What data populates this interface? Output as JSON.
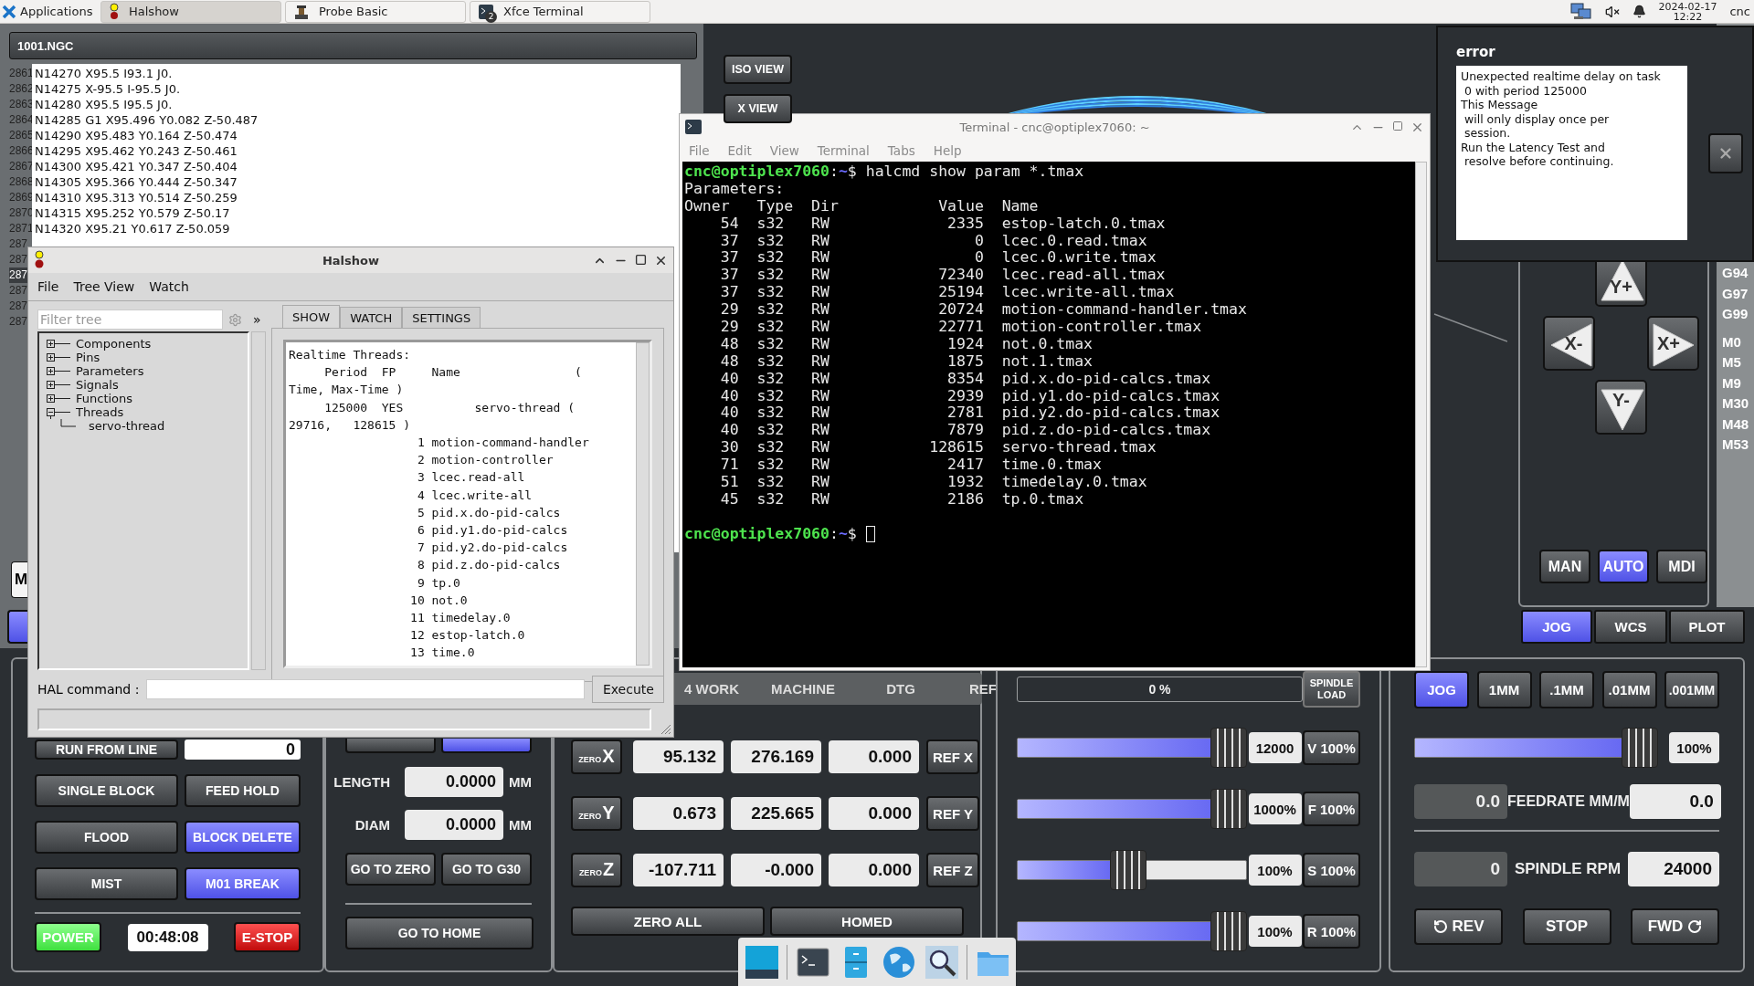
{
  "top_panel": {
    "applications": "Applications",
    "tasks": [
      {
        "label": "Halshow",
        "kind": "halshow",
        "selected": true
      },
      {
        "label": "Probe Basic",
        "kind": "probe",
        "selected": false
      },
      {
        "label": "Xfce Terminal",
        "kind": "terminal",
        "selected": false,
        "badge": "2"
      }
    ],
    "date": "2024-02-17",
    "time": "12:22",
    "user": "cnc"
  },
  "probe_basic": {
    "file_title": "1001.NGC",
    "code_lines": [
      {
        "number": "2861",
        "text": "N14270 X95.5 I93.1 J0.",
        "selected": false
      },
      {
        "number": "2862",
        "text": "N14275 X-95.5 I-95.5 J0.",
        "selected": false
      },
      {
        "number": "2863",
        "text": "N14280 X95.5 I95.5 J0.",
        "selected": false
      },
      {
        "number": "2864",
        "text": "N14285 G1 X95.496 Y0.082 Z-50.487",
        "selected": false
      },
      {
        "number": "2865",
        "text": "N14290 X95.483 Y0.164 Z-50.474",
        "selected": false
      },
      {
        "number": "2866",
        "text": "N14295 X95.462 Y0.243 Z-50.461",
        "selected": false
      },
      {
        "number": "2867",
        "text": "N14300 X95.421 Y0.347 Z-50.404",
        "selected": false
      },
      {
        "number": "2868",
        "text": "N14305 X95.366 Y0.444 Z-50.347",
        "selected": false
      },
      {
        "number": "2869",
        "text": "N14310 X95.313 Y0.514 Z-50.259",
        "selected": false
      },
      {
        "number": "2870",
        "text": "N14315 X95.252 Y0.579 Z-50.17",
        "selected": false
      },
      {
        "number": "2871",
        "text": "N14320 X95.21 Y0.617 Z-50.059",
        "selected": false
      },
      {
        "number": "287",
        "selected": false
      },
      {
        "number": "287",
        "selected": false
      },
      {
        "number": "287",
        "selected": true
      },
      {
        "number": "287",
        "selected": false
      },
      {
        "number": "287",
        "selected": false
      },
      {
        "number": "287",
        "selected": false
      }
    ],
    "mode_stub": "M",
    "view_buttons": [
      "ISO VIEW",
      "X VIEW"
    ],
    "active_gcodes": [
      "G94",
      "G97",
      "G99"
    ],
    "active_mcodes": [
      "M0",
      "M5",
      "M9",
      "M30",
      "M48",
      "M53"
    ],
    "jog_buttons": [
      {
        "label": "Y+",
        "kind": "up"
      },
      {
        "label": "X-",
        "kind": "left"
      },
      {
        "label": "X+",
        "kind": "right"
      },
      {
        "label": "Y-",
        "kind": "down"
      }
    ],
    "modes": [
      {
        "label": "MAN",
        "selected": false
      },
      {
        "label": "AUTO",
        "selected": true
      },
      {
        "label": "MDI",
        "selected": false
      }
    ],
    "view_tabs": [
      {
        "label": "JOG",
        "selected": true
      },
      {
        "label": "WCS",
        "selected": false
      },
      {
        "label": "PLOT",
        "selected": false
      }
    ],
    "program_controls": {
      "run_from_line": "RUN FROM LINE",
      "line_value": "0",
      "toggles": [
        {
          "label": "SINGLE BLOCK",
          "on": false
        },
        {
          "label": "FEED HOLD",
          "on": false
        },
        {
          "label": "FLOOD",
          "on": false
        },
        {
          "label": "BLOCK DELETE",
          "on": true
        },
        {
          "label": "MIST",
          "on": false
        },
        {
          "label": "M01 BREAK",
          "on": true
        }
      ],
      "power": "POWER",
      "timer": "00:48:08",
      "estop": "E-STOP"
    },
    "tool": {
      "toggles": [
        {
          "on": false
        },
        {
          "on": true
        }
      ],
      "length": {
        "label": "LENGTH",
        "value": "0.0000",
        "unit": "MM"
      },
      "diam": {
        "label": "DIAM",
        "value": "0.0000",
        "unit": "MM"
      },
      "goto_zero": "GO TO ZERO",
      "goto_g30": "GO TO G30",
      "goto_home": "GO TO HOME"
    },
    "dro": {
      "headers": [
        "4 WORK",
        "MACHINE",
        "DTG",
        "REF"
      ],
      "axes": [
        {
          "zero": "ZERO",
          "axis": "X",
          "work": "95.132",
          "machine": "276.169",
          "dtg": "0.000",
          "ref": "REF X"
        },
        {
          "zero": "ZERO",
          "axis": "Y",
          "work": "0.673",
          "machine": "225.665",
          "dtg": "0.000",
          "ref": "REF Y"
        },
        {
          "zero": "ZERO",
          "axis": "Z",
          "work": "-107.711",
          "machine": "-0.000",
          "dtg": "0.000",
          "ref": "REF Z"
        }
      ],
      "zero_all": "ZERO ALL",
      "homed": "HOMED"
    },
    "overrides": {
      "spindle_load": {
        "reading": "0 %",
        "level": 0,
        "label": "SPINDLE LOAD"
      },
      "sliders": [
        {
          "level": 1,
          "reading": "12000",
          "button": "V 100%"
        },
        {
          "level": 1,
          "reading": "1000%",
          "button": "F 100%"
        },
        {
          "level": 0.48,
          "reading": "100%",
          "button": "S 100%"
        },
        {
          "level": 1,
          "reading": "100%",
          "button": "R 100%"
        }
      ]
    },
    "jog": {
      "increments": [
        {
          "label": "JOG",
          "selected": true
        },
        {
          "label": "1MM",
          "selected": false
        },
        {
          "label": ".1MM",
          "selected": false
        },
        {
          "label": ".01MM",
          "selected": false
        },
        {
          "label": ".001MM",
          "selected": false
        }
      ],
      "speed": {
        "level": 1,
        "reading": "100%"
      },
      "feedrate": {
        "actual": "0.0",
        "label": "FEEDRATE MM/M",
        "commanded": "0.0"
      },
      "spindle": {
        "actual": "0",
        "label": "SPINDLE RPM",
        "commanded": "24000"
      },
      "spindle_buttons": [
        {
          "label": "REV",
          "kind": "rev"
        },
        {
          "label": "STOP",
          "kind": "stop"
        },
        {
          "label": "FWD",
          "kind": "fwd"
        }
      ]
    }
  },
  "halshow": {
    "title": "Halshow",
    "menu": [
      "File",
      "Tree View",
      "Watch"
    ],
    "filter_placeholder": "Filter tree",
    "more": "»",
    "tree": [
      {
        "label": "Components",
        "expanded": false
      },
      {
        "label": "Pins",
        "expanded": false
      },
      {
        "label": "Parameters",
        "expanded": false
      },
      {
        "label": "Signals",
        "expanded": false
      },
      {
        "label": "Functions",
        "expanded": false
      },
      {
        "label": "Threads",
        "expanded": true,
        "children": [
          {
            "label": "servo-thread"
          }
        ]
      }
    ],
    "tabs": [
      {
        "label": "SHOW",
        "selected": true
      },
      {
        "label": "WATCH",
        "selected": false
      },
      {
        "label": "SETTINGS",
        "selected": false
      }
    ],
    "show_lines": [
      "Realtime Threads:",
      "     Period  FP     Name                (",
      "Time, Max-Time )",
      "     125000  YES          servo-thread (",
      "29716,   128615 )",
      "                  1 motion-command-handler",
      "                  2 motion-controller",
      "                  3 lcec.read-all",
      "                  4 lcec.write-all",
      "                  5 pid.x.do-pid-calcs",
      "                  6 pid.y1.do-pid-calcs",
      "                  7 pid.y2.do-pid-calcs",
      "                  8 pid.z.do-pid-calcs",
      "                  9 tp.0",
      "                 10 not.0",
      "                 11 timedelay.0",
      "                 12 estop-latch.0",
      "                 13 time.0"
    ],
    "hal_command_label": "HAL command :",
    "execute": "Execute"
  },
  "terminal": {
    "title": "Terminal - cnc@optiplex7060: ~",
    "menu": [
      "File",
      "Edit",
      "View",
      "Terminal",
      "Tabs",
      "Help"
    ],
    "lines": [
      {
        "kind": "prompt",
        "user_host": "cnc@optiplex7060",
        "separator": ":",
        "path": "~",
        "sigil": "$",
        "command": "halcmd show param *.tmax"
      },
      {
        "kind": "text",
        "text": "Parameters:"
      },
      {
        "kind": "text",
        "text": "Owner   Type  Dir           Value  Name"
      },
      {
        "kind": "text",
        "text": "    54  s32   RW             2335  estop-latch.0.tmax"
      },
      {
        "kind": "text",
        "text": "    37  s32   RW                0  lcec.0.read.tmax"
      },
      {
        "kind": "text",
        "text": "    37  s32   RW                0  lcec.0.write.tmax"
      },
      {
        "kind": "text",
        "text": "    37  s32   RW            72340  lcec.read-all.tmax"
      },
      {
        "kind": "text",
        "text": "    37  s32   RW            25194  lcec.write-all.tmax"
      },
      {
        "kind": "text",
        "text": "    29  s32   RW            20724  motion-command-handler.tmax"
      },
      {
        "kind": "text",
        "text": "    29  s32   RW            22771  motion-controller.tmax"
      },
      {
        "kind": "text",
        "text": "    48  s32   RW             1924  not.0.tmax"
      },
      {
        "kind": "text",
        "text": "    48  s32   RW             1875  not.1.tmax"
      },
      {
        "kind": "text",
        "text": "    40  s32   RW             8354  pid.x.do-pid-calcs.tmax"
      },
      {
        "kind": "text",
        "text": "    40  s32   RW             2939  pid.y1.do-pid-calcs.tmax"
      },
      {
        "kind": "text",
        "text": "    40  s32   RW             2781  pid.y2.do-pid-calcs.tmax"
      },
      {
        "kind": "text",
        "text": "    40  s32   RW             7879  pid.z.do-pid-calcs.tmax"
      },
      {
        "kind": "text",
        "text": "    30  s32   RW           128615  servo-thread.tmax"
      },
      {
        "kind": "text",
        "text": "    71  s32   RW             2417  time.0.tmax"
      },
      {
        "kind": "text",
        "text": "    51  s32   RW             1932  timedelay.0.tmax"
      },
      {
        "kind": "text",
        "text": "    45  s32   RW             2186  tp.0.tmax"
      },
      {
        "kind": "blank"
      },
      {
        "kind": "prompt",
        "user_host": "cnc@optiplex7060",
        "separator": ":",
        "path": "~",
        "sigil": "$",
        "cursor": true
      }
    ]
  },
  "error_popup": {
    "title": "error",
    "message": "Unexpected realtime delay on task\n 0 with period 125000\nThis Message\n will only display once per\n session.\nRun the Latency Test and\n resolve before continuing."
  }
}
